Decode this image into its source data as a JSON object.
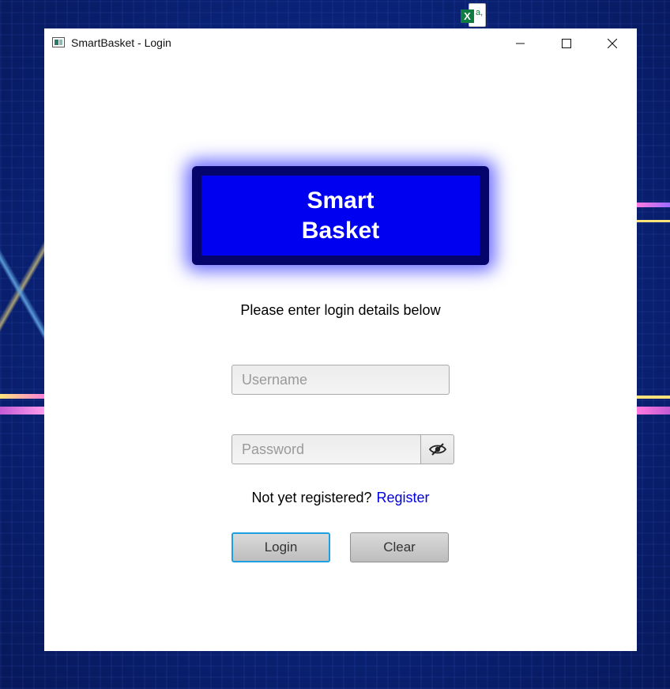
{
  "window": {
    "title": "SmartBasket - Login"
  },
  "logo": {
    "line1": "Smart",
    "line2": "Basket"
  },
  "instructions": "Please enter login details below",
  "username": {
    "placeholder": "Username",
    "value": ""
  },
  "password": {
    "placeholder": "Password",
    "value": ""
  },
  "register": {
    "prompt": "Not yet registered?",
    "link": "Register"
  },
  "buttons": {
    "login": "Login",
    "clear": "Clear"
  },
  "icons": {
    "app": "app-window-icon",
    "desktop_file": "excel-file-icon",
    "password_toggle": "eye-slash-icon"
  },
  "colors": {
    "logo_fill": "#0000f0",
    "logo_border": "#04046a",
    "link": "#0000e0",
    "focus": "#1ea0e0"
  }
}
